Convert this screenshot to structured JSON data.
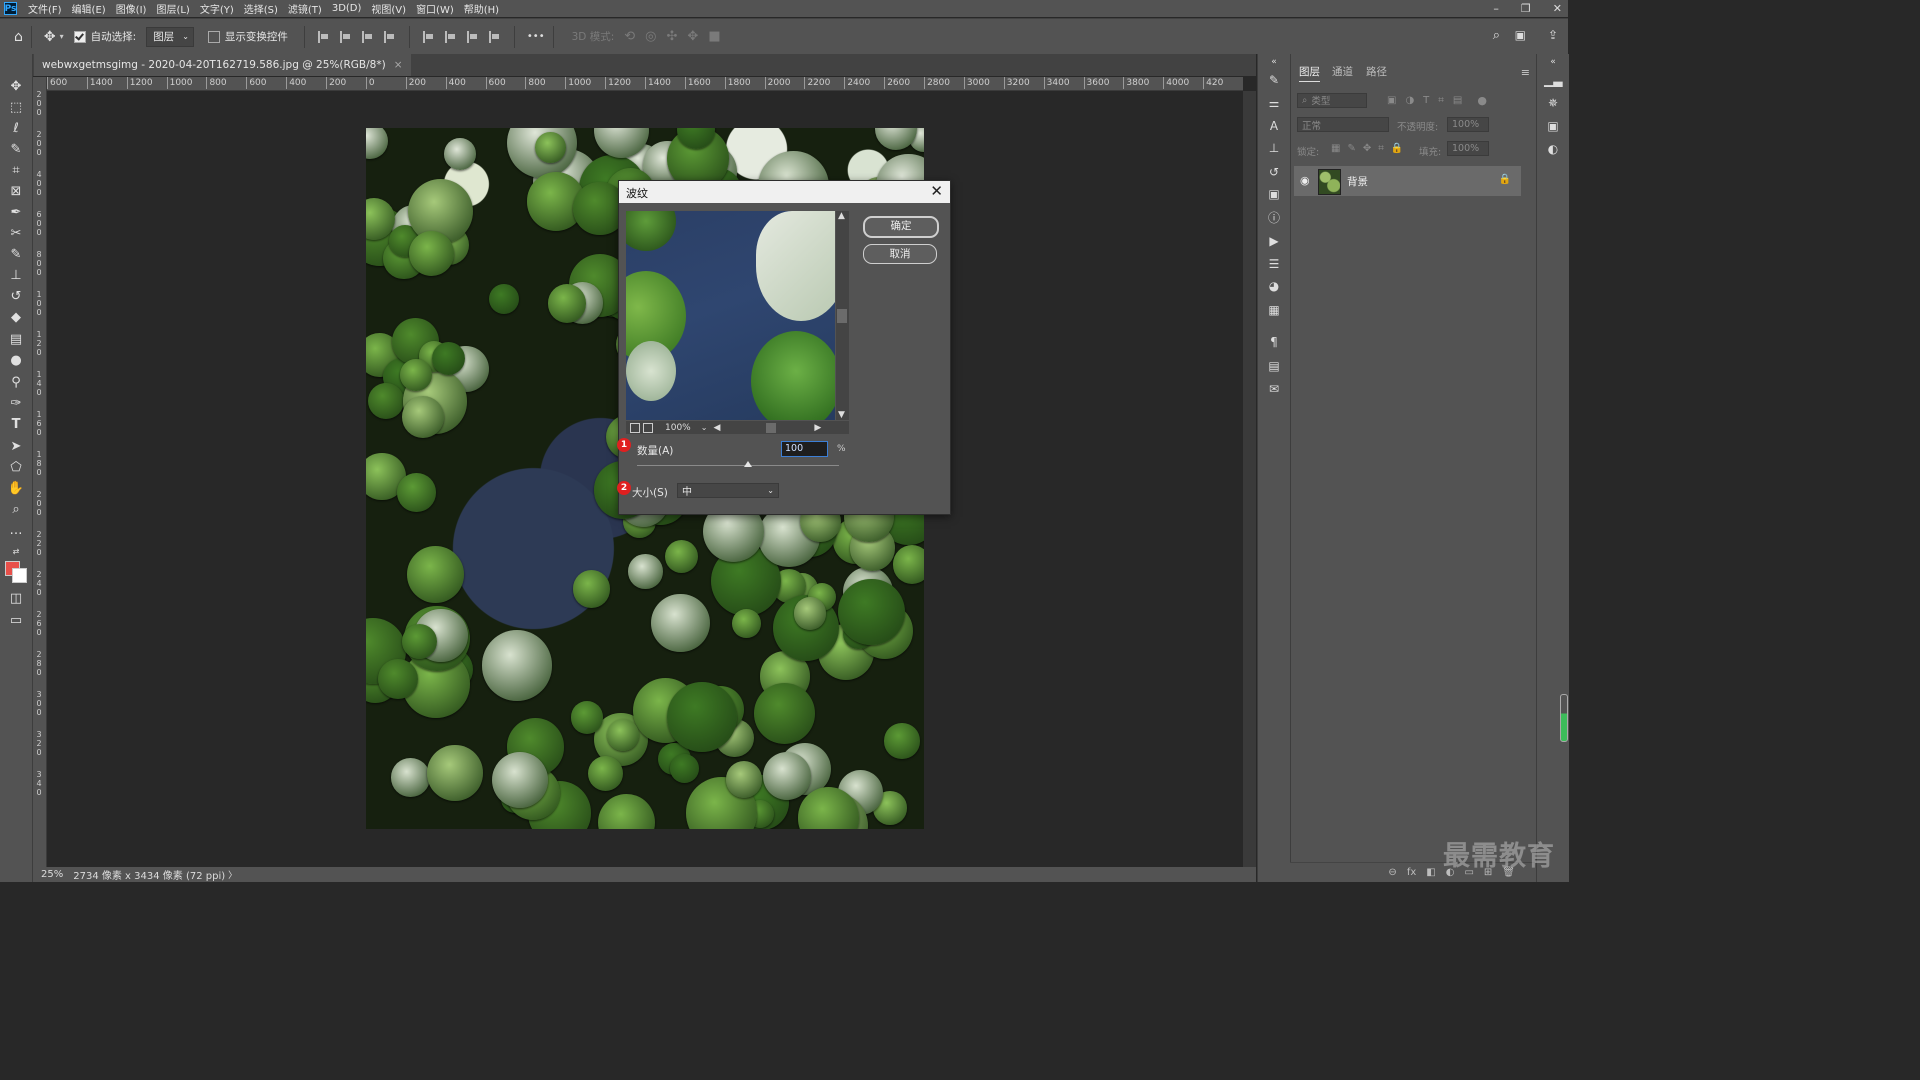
{
  "app": {
    "logo": "Ps",
    "menu": [
      "文件(F)",
      "编辑(E)",
      "图像(I)",
      "图层(L)",
      "文字(Y)",
      "选择(S)",
      "滤镜(T)",
      "3D(D)",
      "视图(V)",
      "窗口(W)",
      "帮助(H)"
    ],
    "window_controls": {
      "minimize": "–",
      "restore": "❐",
      "close": "✕"
    }
  },
  "options_bar": {
    "auto_select_label": "自动选择:",
    "auto_select_checked": true,
    "auto_select_target": "图层",
    "show_transform_label": "显示变换控件",
    "show_transform_checked": false,
    "more_label": "•••",
    "mode_3d_label": "3D 模式:"
  },
  "document": {
    "tab_title": "webwxgetmsgimg - 2020-04-20T162719.586.jpg @ 25%(RGB/8*)",
    "tab_close": "×",
    "ruler_h": [
      "600",
      "1400",
      "1200",
      "1000",
      "800",
      "600",
      "400",
      "200",
      "0",
      "200",
      "400",
      "600",
      "800",
      "1000",
      "1200",
      "1400",
      "1600",
      "1800",
      "2000",
      "2200",
      "2400",
      "2600",
      "2800",
      "3000",
      "3200",
      "3400",
      "3600",
      "3800",
      "4000",
      "420"
    ],
    "ruler_v": [
      "2",
      "0",
      "0",
      "2",
      "0",
      "0",
      "4",
      "0",
      "0",
      "6",
      "0",
      "0",
      "8",
      "0",
      "0",
      "1",
      "0",
      "0",
      "1",
      "2",
      "0",
      "1",
      "4",
      "0",
      "1",
      "6",
      "0",
      "1",
      "8",
      "0",
      "2",
      "0",
      "0",
      "2",
      "2",
      "0",
      "2",
      "4",
      "0",
      "2",
      "6",
      "0",
      "2",
      "8",
      "0",
      "3",
      "0",
      "0",
      "3",
      "2",
      "0",
      "3",
      "4",
      "0"
    ]
  },
  "dialog": {
    "title": "波纹",
    "close": "✕",
    "ok_label": "确定",
    "cancel_label": "取消",
    "preview_zoom": "100%",
    "amount_label": "数量(A)",
    "amount_value": "100",
    "amount_unit": "%",
    "amount_level": 0.55,
    "size_label": "大小(S)",
    "size_value": "中",
    "badge_1": "1",
    "badge_2": "2"
  },
  "layers_panel": {
    "tabs": [
      "图层",
      "通道",
      "路径"
    ],
    "filter_kind": "类型",
    "blend_mode": "正常",
    "opacity_label": "不透明度:",
    "opacity_value": "100%",
    "lock_label": "锁定:",
    "fill_label": "填充:",
    "fill_value": "100%",
    "layer_name": "背景",
    "footer_icons": [
      "⊖",
      "fx",
      "◧",
      "◐",
      "▭",
      "⊞",
      "🗑"
    ]
  },
  "status": {
    "zoom": "25%",
    "doc_info": "2734 像素 x 3434 像素 (72 ppi)"
  },
  "watermark": "最需教育",
  "colors": {
    "foreground": "#e8504a",
    "background": "#ffffff",
    "accent_blue": "#3c7fd6",
    "badge_red": "#e02020"
  }
}
